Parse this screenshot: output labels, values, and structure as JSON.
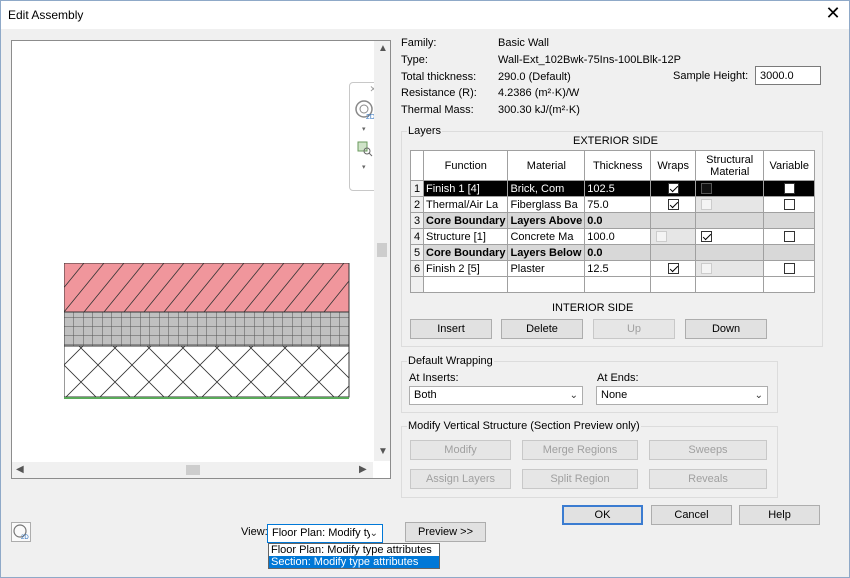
{
  "window": {
    "title": "Edit Assembly",
    "close_glyph": "✕"
  },
  "info": {
    "family_label": "Family:",
    "family": "Basic Wall",
    "type_label": "Type:",
    "type": "Wall-Ext_102Bwk-75Ins-100LBlk-12P",
    "thickness_label": "Total thickness:",
    "thickness": "290.0 (Default)",
    "resistance_label": "Resistance (R):",
    "resistance": "4.2386 (m²·K)/W",
    "mass_label": "Thermal Mass:",
    "mass": "300.30 kJ/(m²·K)",
    "sample_height_label": "Sample Height:",
    "sample_height": "3000.0"
  },
  "layers": {
    "group_label": "Layers",
    "exterior_label": "EXTERIOR SIDE",
    "interior_label": "INTERIOR SIDE",
    "headers": [
      "",
      "Function",
      "Material",
      "Thickness",
      "Wraps",
      "Structural Material",
      "Variable"
    ],
    "rows": [
      {
        "num": "1",
        "function": "Finish 1 [4]",
        "material": "Brick, Com",
        "thickness": "102.5"
      },
      {
        "num": "2",
        "function": "Thermal/Air La",
        "material": "Fiberglass Ba",
        "thickness": "75.0"
      },
      {
        "num": "3",
        "function": "Core Boundary",
        "material": "Layers Above",
        "thickness": "0.0"
      },
      {
        "num": "4",
        "function": "Structure [1]",
        "material": "Concrete Ma",
        "thickness": "100.0"
      },
      {
        "num": "5",
        "function": "Core Boundary",
        "material": "Layers Below",
        "thickness": "0.0"
      },
      {
        "num": "6",
        "function": "Finish 2 [5]",
        "material": "Plaster",
        "thickness": "12.5"
      }
    ],
    "buttons": {
      "insert": "Insert",
      "delete": "Delete",
      "up": "Up",
      "down": "Down"
    }
  },
  "wrapping": {
    "group_label": "Default Wrapping",
    "inserts_label": "At Inserts:",
    "inserts_value": "Both",
    "ends_label": "At Ends:",
    "ends_value": "None"
  },
  "vertical": {
    "group_label": "Modify Vertical Structure (Section Preview only)",
    "modify": "Modify",
    "merge": "Merge Regions",
    "sweeps": "Sweeps",
    "assign": "Assign Layers",
    "split": "Split Region",
    "reveals": "Reveals"
  },
  "footer": {
    "ok": "OK",
    "cancel": "Cancel",
    "help": "Help",
    "view_label": "View:",
    "view_value": "Floor Plan: Modify typ",
    "preview": "Preview >>",
    "view_options": [
      "Floor Plan: Modify type attributes",
      "Section: Modify type attributes"
    ]
  },
  "colors": {
    "brick": "#f0969c",
    "accent": "#0078d7"
  }
}
